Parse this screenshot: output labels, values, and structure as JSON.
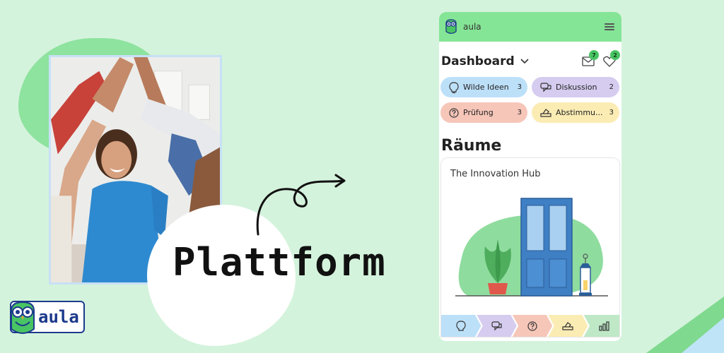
{
  "headline": "Plattform",
  "brand": {
    "name": "aula"
  },
  "app": {
    "name": "aula",
    "dashboard_title": "Dashboard",
    "messages_count": "7",
    "likes_count": "2",
    "chips": [
      {
        "label": "Wilde Ideen",
        "count": "3",
        "icon": "lightbulb-icon"
      },
      {
        "label": "Diskussion",
        "count": "2",
        "icon": "chat-bubbles-icon"
      },
      {
        "label": "Prüfung",
        "count": "3",
        "icon": "question-circle-icon"
      },
      {
        "label": "Abstimmu...",
        "count": "3",
        "icon": "ballot-box-icon"
      }
    ],
    "rooms_title": "Räume",
    "room": {
      "name": "The Innovation Hub"
    },
    "phases": [
      "lightbulb-icon",
      "chat-bubbles-icon",
      "question-circle-icon",
      "ballot-box-icon",
      "bar-chart-icon"
    ]
  },
  "colors": {
    "background": "#d4f3dc",
    "topbar": "#85e596",
    "brand_blue": "#1c3a8c",
    "chip_blue": "#bde0f9",
    "chip_purple": "#d5ccef",
    "chip_red": "#f6c6b9",
    "chip_yellow": "#fbecb4"
  }
}
